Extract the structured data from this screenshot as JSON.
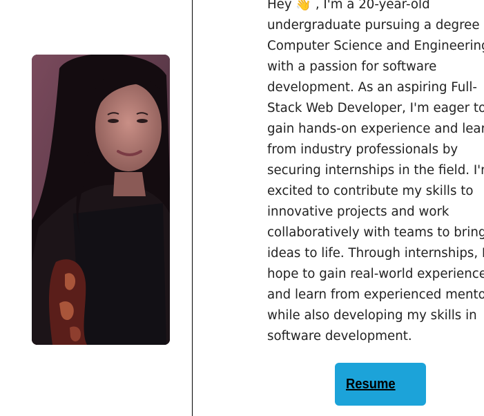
{
  "profile": {
    "photo_alt": "profile photo"
  },
  "about": {
    "lines": [
      "Hey 👋 , I'm a 20-year-old",
      "undergraduate pursuing a degree in",
      "Computer Science and Engineering,",
      "with a passion for software",
      "development. As an aspiring Full-",
      "Stack Web Developer, I'm eager to",
      "gain hands-on experience and learn",
      "from industry professionals by",
      "securing internships in the field. I'm",
      "excited to contribute my skills to",
      "innovative projects and work",
      "collaboratively with teams to bring",
      "ideas to life. Through internships, I",
      "hope to gain real-world experience",
      "and learn from experienced mentors",
      "while also developing my skills in",
      "software development."
    ]
  },
  "actions": {
    "resume_label": "Resume"
  },
  "colors": {
    "resume_button": "#1ca3d9",
    "divider": "#000000",
    "text": "#222222"
  }
}
